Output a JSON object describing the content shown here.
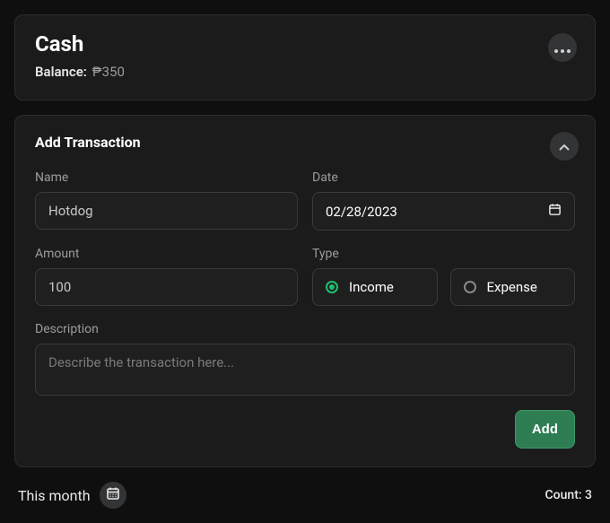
{
  "account": {
    "title": "Cash",
    "balance_label": "Balance:",
    "balance_value": "₱350"
  },
  "form": {
    "title": "Add Transaction",
    "name_label": "Name",
    "name_value": "Hotdog",
    "date_label": "Date",
    "date_value": "02/28/2023",
    "amount_label": "Amount",
    "amount_value": "100",
    "type_label": "Type",
    "type_options": {
      "income": "Income",
      "expense": "Expense"
    },
    "type_selected": "income",
    "description_label": "Description",
    "description_placeholder": "Describe the transaction here...",
    "add_button": "Add"
  },
  "footer": {
    "period_label": "This month",
    "count_label": "Count: 3"
  }
}
